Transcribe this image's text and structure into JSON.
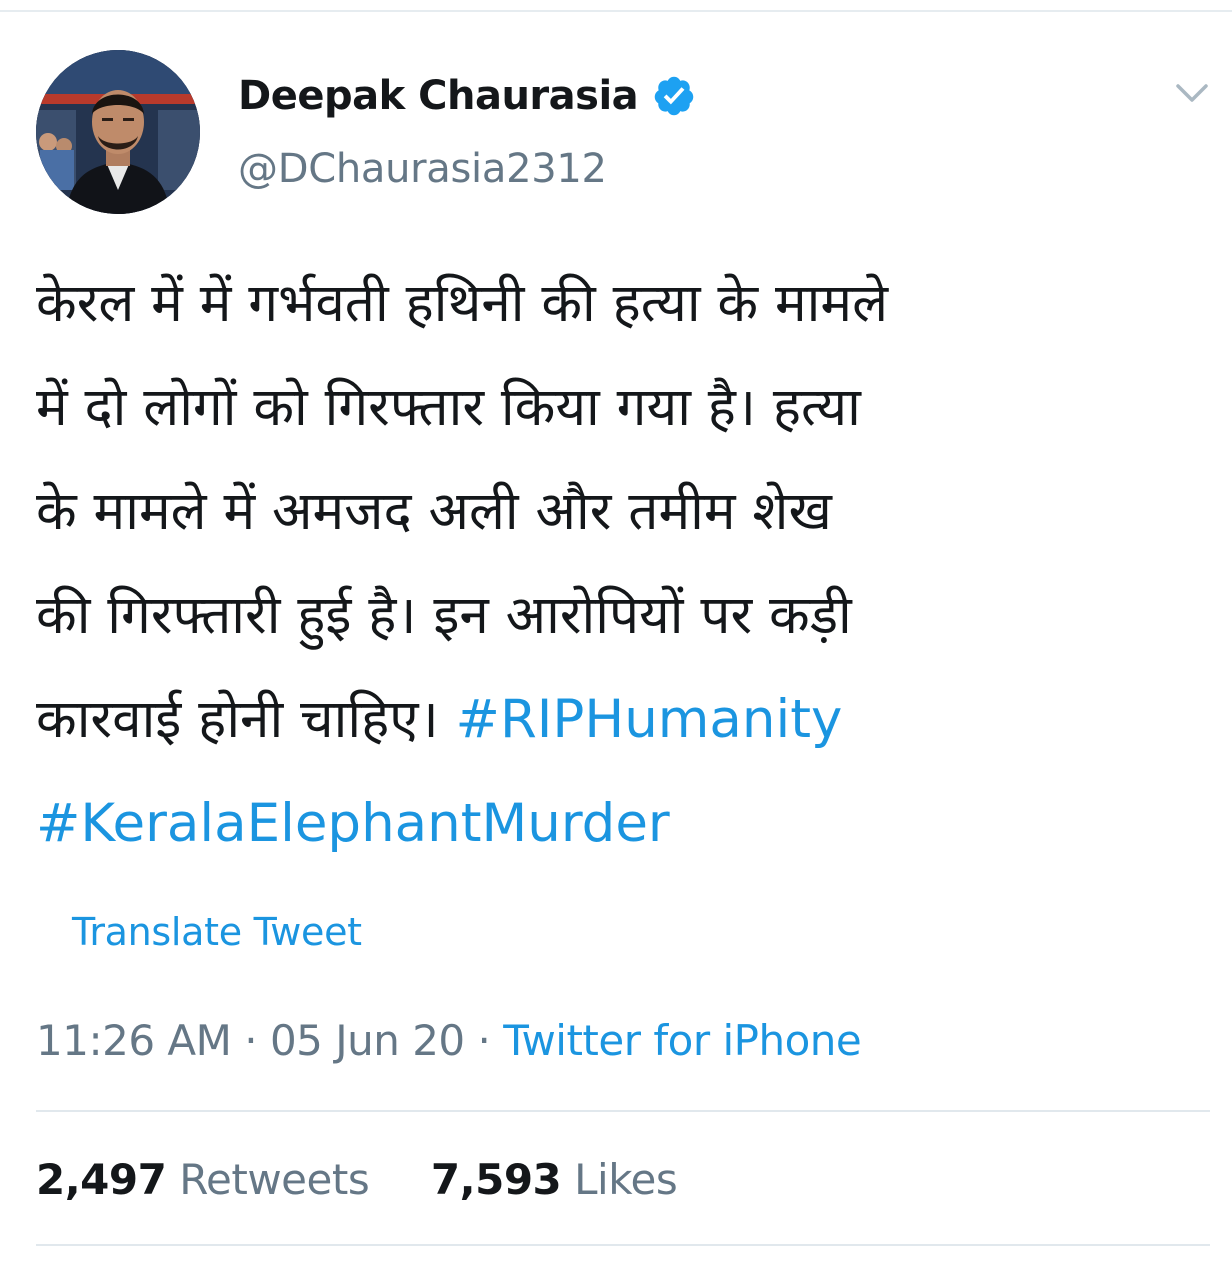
{
  "tweet": {
    "author": {
      "display_name": "Deepak Chaurasia",
      "handle": "@DChaurasia2312",
      "verified": true
    },
    "text_lines": [
      "केरल में में गर्भवती हथिनी की हत्या के मामले",
      "में दो लोगों को गिरफ्तार किया गया है। हत्या",
      "के मामले में अमजद अली और तमीम शेख",
      "की गिरफ्तारी हुई है। इन आरोपियों पर कड़ी"
    ],
    "last_line_text": "कारवाई होनी चाहिए। ",
    "hashtags": [
      "#RIPHumanity",
      "#KeralaElephantMurder"
    ],
    "translate_label": "Translate Tweet",
    "time": "11:26 AM",
    "date": "05 Jun 20",
    "separator": "·",
    "source": "Twitter for iPhone",
    "stats": {
      "retweets_count": "2,497",
      "retweets_label": "Retweets",
      "likes_count": "7,593",
      "likes_label": "Likes"
    }
  },
  "icons": {
    "verified": "verified-badge-icon",
    "menu": "chevron-down-icon"
  },
  "colors": {
    "link": "#1b95e0",
    "text": "#14171a",
    "secondary": "#657786",
    "divider": "#e1e8ed"
  }
}
